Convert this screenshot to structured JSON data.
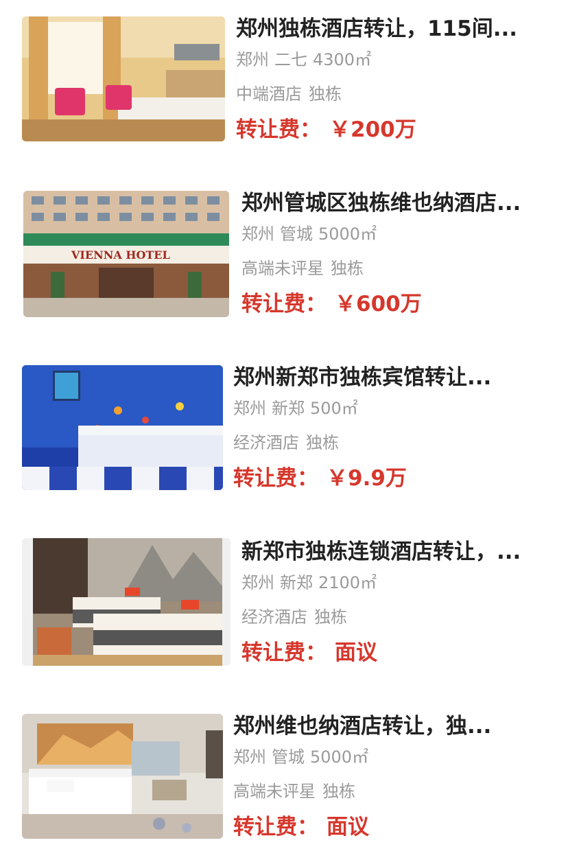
{
  "listings": [
    {
      "title": "郑州独栋酒店转让，115间...",
      "city": "郑州",
      "district": "二七",
      "area": "4300㎡",
      "tag1": "中端酒店",
      "tag2": "独栋",
      "price_label": "转让费：",
      "price_value": "￥200万"
    },
    {
      "title": "郑州管城区独栋维也纳酒店...",
      "city": "郑州",
      "district": "管城",
      "area": "5000㎡",
      "tag1": "高端未评星",
      "tag2": "独栋",
      "price_label": "转让费：",
      "price_value": "￥600万",
      "image_sign_text": "VIENNA HOTEL"
    },
    {
      "title": "郑州新郑市独栋宾馆转让...",
      "city": "郑州",
      "district": "新郑",
      "area": "500㎡",
      "tag1": "经济酒店",
      "tag2": "独栋",
      "price_label": "转让费：",
      "price_value": "￥9.9万"
    },
    {
      "title": "新郑市独栋连锁酒店转让，...",
      "city": "郑州",
      "district": "新郑",
      "area": "2100㎡",
      "tag1": "经济酒店",
      "tag2": "独栋",
      "price_label": "转让费：",
      "price_value": "面议"
    },
    {
      "title": "郑州维也纳酒店转让，独...",
      "city": "郑州",
      "district": "管城",
      "area": "5000㎡",
      "tag1": "高端未评星",
      "tag2": "独栋",
      "price_label": "转让费：",
      "price_value": "面议"
    }
  ],
  "colors": {
    "title": "#222222",
    "meta": "#9a9a9a",
    "price": "#d6372c"
  }
}
